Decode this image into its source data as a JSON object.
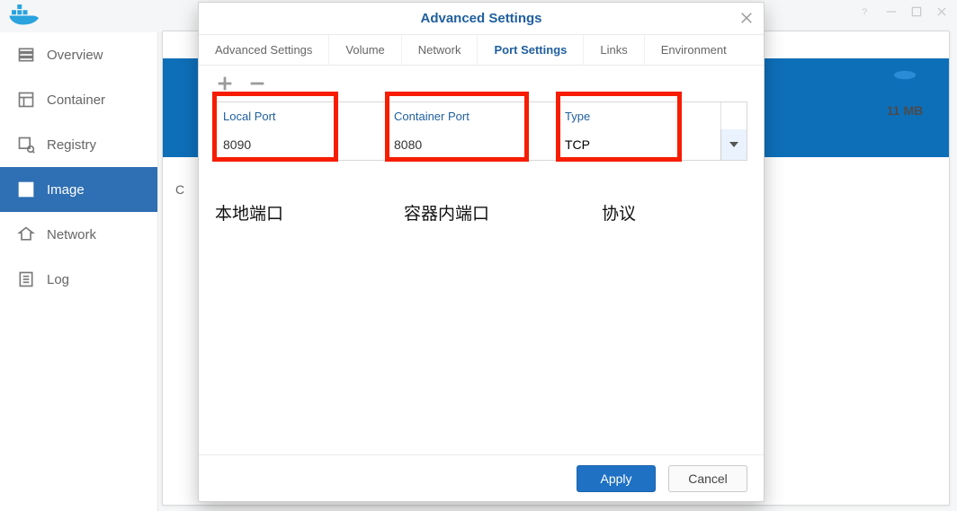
{
  "window": {
    "title": "Docker"
  },
  "sidebar": {
    "items": [
      {
        "label": "Overview"
      },
      {
        "label": "Container"
      },
      {
        "label": "Registry"
      },
      {
        "label": "Image"
      },
      {
        "label": "Network"
      },
      {
        "label": "Log"
      }
    ]
  },
  "bgpanel": {
    "c_label": "C"
  },
  "right_info": {
    "size_text": "11 MB"
  },
  "modal": {
    "title": "Advanced Settings",
    "tabs": [
      {
        "label": "Advanced Settings"
      },
      {
        "label": "Volume"
      },
      {
        "label": "Network"
      },
      {
        "label": "Port Settings"
      },
      {
        "label": "Links"
      },
      {
        "label": "Environment"
      }
    ],
    "columns": {
      "local": "Local Port",
      "container": "Container Port",
      "type": "Type"
    },
    "row": {
      "local": "8090",
      "container": "8080",
      "type": "TCP"
    },
    "captions": {
      "local": "本地端口",
      "container": "容器内端口",
      "type": "协议"
    },
    "buttons": {
      "apply": "Apply",
      "cancel": "Cancel"
    }
  }
}
